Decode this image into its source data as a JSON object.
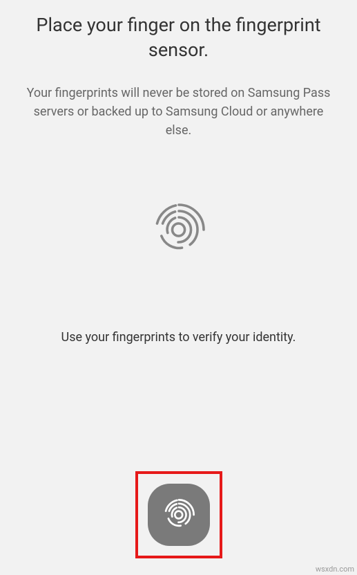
{
  "title": "Place your finger on the fingerprint sensor.",
  "subtitle": "Your fingerprints will never be stored on Samsung Pass servers or backed up to Samsung Cloud or anywhere else.",
  "instruction": "Use your fingerprints to verify your identity.",
  "watermark": "wsxdn.com"
}
